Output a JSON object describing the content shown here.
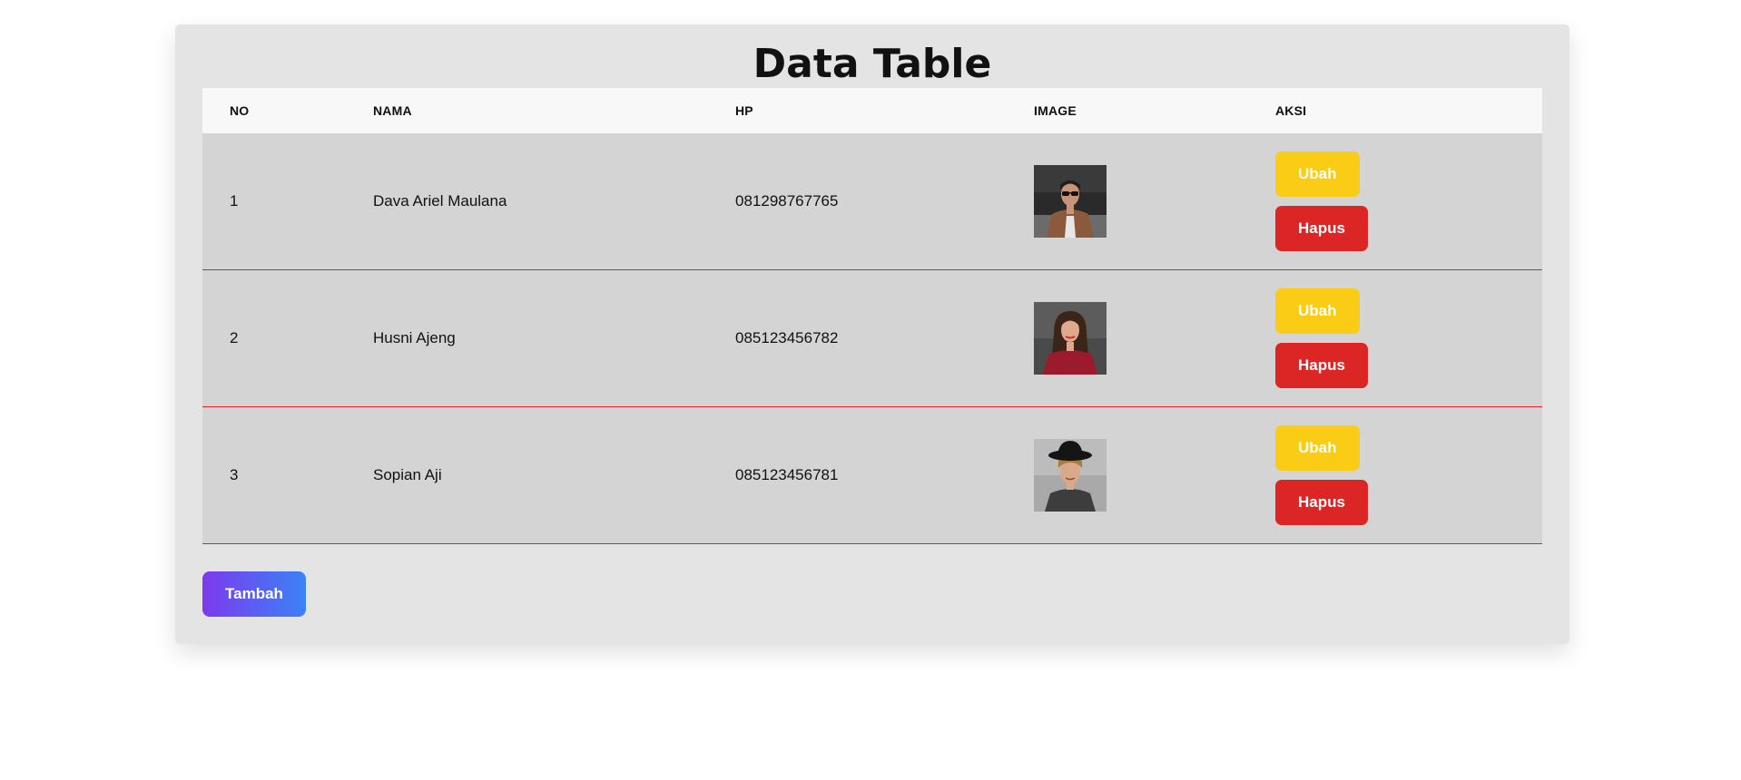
{
  "page": {
    "title": "Data Table"
  },
  "table": {
    "headers": {
      "no": "NO",
      "nama": "NAMA",
      "hp": "HP",
      "image": "IMAGE",
      "aksi": "AKSI"
    },
    "rows": [
      {
        "no": "1",
        "nama": "Dava Ariel Maulana",
        "hp": "081298767765",
        "image": "man-with-sunglasses-photo",
        "edit_label": "Ubah",
        "delete_label": "Hapus"
      },
      {
        "no": "2",
        "nama": "Husni Ajeng",
        "hp": "085123456782",
        "image": "woman-in-red-sweater-photo",
        "edit_label": "Ubah",
        "delete_label": "Hapus"
      },
      {
        "no": "3",
        "nama": "Sopian Aji",
        "hp": "085123456781",
        "image": "man-with-black-hat-photo",
        "edit_label": "Ubah",
        "delete_label": "Hapus"
      }
    ]
  },
  "actions": {
    "add_label": "Tambah"
  },
  "colors": {
    "edit_button": "#facc15",
    "delete_button": "#dc2626",
    "add_gradient_start": "#7c3aed",
    "add_gradient_end": "#3b82f6",
    "row_divider": "#dc2626"
  }
}
